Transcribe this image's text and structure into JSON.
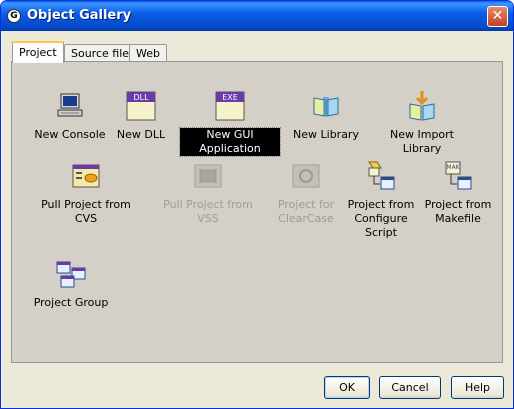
{
  "window": {
    "title": "Object Gallery",
    "close_glyph": "✕",
    "app_icon_glyph": "G"
  },
  "tabs": [
    {
      "label": "Project",
      "active": true
    },
    {
      "label": "Source file",
      "active": false
    },
    {
      "label": "Web",
      "active": false
    }
  ],
  "items": [
    {
      "label": "New Console",
      "icon": "console-icon",
      "selected": false,
      "disabled": false
    },
    {
      "label": "New DLL",
      "icon": "dll-file-icon",
      "selected": false,
      "disabled": false
    },
    {
      "label": "New GUI Application",
      "icon": "exe-file-icon",
      "selected": true,
      "disabled": false
    },
    {
      "label": "New Library",
      "icon": "library-icon",
      "selected": false,
      "disabled": false
    },
    {
      "label": "New Import Library",
      "icon": "import-library-icon",
      "selected": false,
      "disabled": false
    },
    {
      "label": "Pull Project from CVS",
      "icon": "cvs-icon",
      "selected": false,
      "disabled": false
    },
    {
      "label": "Pull Project from VSS",
      "icon": "vss-icon",
      "selected": false,
      "disabled": true
    },
    {
      "label": "Project for\nClearCase",
      "icon": "clearcase-icon",
      "selected": false,
      "disabled": true
    },
    {
      "label": "Project from\nConfigure\nScript",
      "icon": "configure-script-icon",
      "selected": false,
      "disabled": false
    },
    {
      "label": "Project from\nMakefile",
      "icon": "makefile-icon",
      "selected": false,
      "disabled": false
    },
    {
      "label": "Project Group",
      "icon": "project-group-icon",
      "selected": false,
      "disabled": false
    }
  ],
  "icon_text": {
    "dll": "DLL",
    "exe": "EXE",
    "mak": "MAK"
  },
  "buttons": {
    "ok": "OK",
    "cancel": "Cancel",
    "help": "Help"
  },
  "colors": {
    "titlebar": "#0a5fe8",
    "selection": "#000000",
    "disabled_text": "#9c9c9c",
    "tab_highlight": "#ffc83c"
  }
}
